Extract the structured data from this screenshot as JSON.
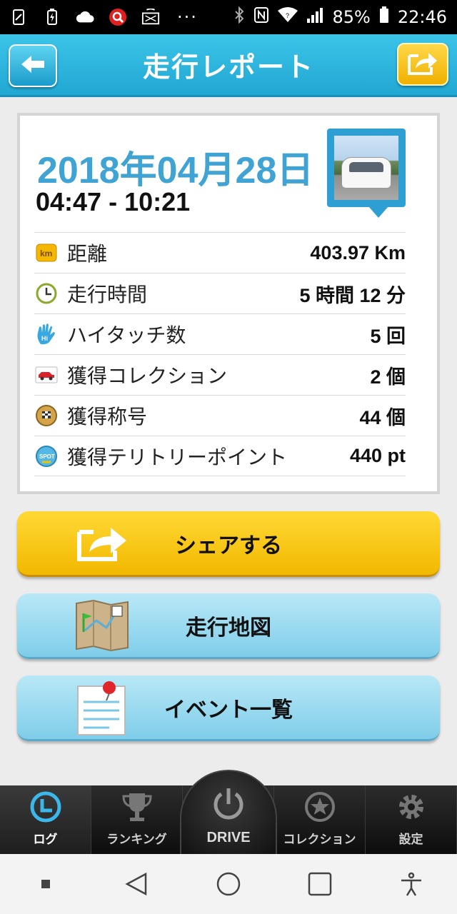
{
  "status_bar": {
    "battery": "85%",
    "time": "22:46",
    "dots": "···"
  },
  "header": {
    "title": "走行レポート"
  },
  "report": {
    "date": "2018年04月28日",
    "time_range": "04:47 - 10:21",
    "stats": [
      {
        "icon": "km-icon",
        "label": "距離",
        "value": "403.97 Km"
      },
      {
        "icon": "clock-icon",
        "label": "走行時間",
        "value": "5 時間 12 分"
      },
      {
        "icon": "hi-hand-icon",
        "label": "ハイタッチ数",
        "value": "5 回"
      },
      {
        "icon": "car-card-icon",
        "label": "獲得コレクション",
        "value": "2 個"
      },
      {
        "icon": "checkered-medal-icon",
        "label": "獲得称号",
        "value": "44 個"
      },
      {
        "icon": "spot-badge-icon",
        "label": "獲得テリトリーポイント",
        "value": "440 pt"
      }
    ]
  },
  "actions": {
    "share": "シェアする",
    "map": "走行地図",
    "events": "イベント一覧"
  },
  "tabs": {
    "log": "ログ",
    "ranking": "ランキング",
    "drive": "DRIVE",
    "collection": "コレクション",
    "settings": "設定"
  },
  "colors": {
    "header": "#21a7d3",
    "date": "#3fa3d3",
    "share": "#f2b800",
    "secondary_button": "#7fcde9"
  }
}
